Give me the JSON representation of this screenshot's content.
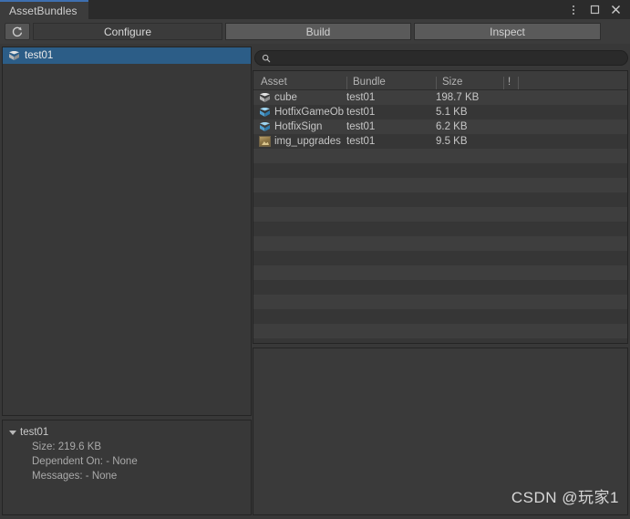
{
  "window": {
    "tab_title": "AssetBundles",
    "controls": [
      {
        "name": "kebab-menu",
        "glyph": "⋮"
      },
      {
        "name": "maximize",
        "glyph": "▢"
      },
      {
        "name": "close",
        "glyph": "✕"
      }
    ]
  },
  "toolbar": {
    "refresh_label": "⟳",
    "modes": [
      {
        "label": "Configure",
        "selected": true
      },
      {
        "label": "Build",
        "selected": false
      },
      {
        "label": "Inspect",
        "selected": false
      }
    ]
  },
  "bundle_tree": {
    "items": [
      {
        "label": "test01",
        "icon": "bundle-cube-icon",
        "selected": true
      }
    ]
  },
  "search": {
    "placeholder": "",
    "value": "",
    "icon": "search-icon"
  },
  "asset_list": {
    "columns": [
      "Asset",
      "Bundle",
      "Size",
      "!"
    ],
    "rows": [
      {
        "asset": "cube",
        "icon": "prefab-cube-grey-icon",
        "bundle": "test01",
        "size": "198.7 KB"
      },
      {
        "asset": "HotfixGameOb",
        "icon": "prefab-cube-blue-icon",
        "bundle": "test01",
        "size": "5.1 KB"
      },
      {
        "asset": "HotfixSign",
        "icon": "prefab-cube-blue-icon",
        "bundle": "test01",
        "size": "6.2 KB"
      },
      {
        "asset": "img_upgrades",
        "icon": "texture-icon",
        "bundle": "test01",
        "size": "9.5 KB"
      }
    ]
  },
  "bundle_details": {
    "title": "test01",
    "lines": [
      "Size: 219.6 KB",
      "Dependent On: - None",
      "Messages: - None"
    ]
  },
  "watermark": {
    "text": "CSDN @玩家1"
  },
  "colors": {
    "accent_tab": "#3e6fb0",
    "selection": "#2c5d87",
    "panel_bg": "#383838",
    "toolbar_bg": "#3c3c3c"
  }
}
